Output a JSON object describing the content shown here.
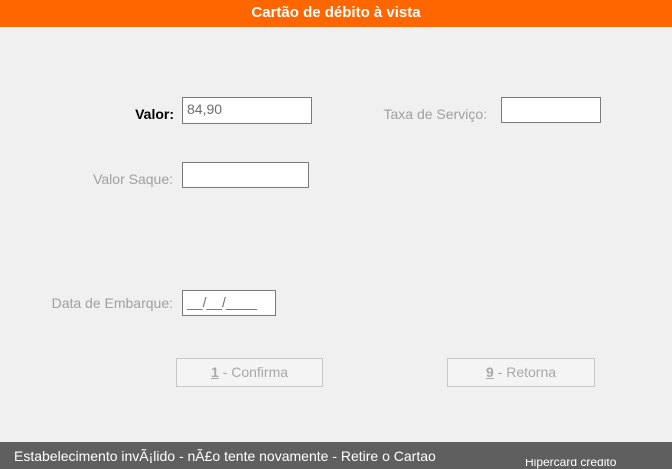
{
  "window": {
    "title": "Cartão de débito à vista"
  },
  "form": {
    "valor_label": "Valor:",
    "valor_value": "84,90",
    "taxa_label": "Taxa de Serviço:",
    "taxa_value": "",
    "saque_label": "Valor Saque:",
    "saque_value": "",
    "embarque_label": "Data de Embarque:",
    "embarque_value": "__/__/____"
  },
  "buttons": {
    "confirma_key": "1",
    "confirma_text": " - Confirma",
    "retorna_key": "9",
    "retorna_text": " - Retorna"
  },
  "status": {
    "message": "Estabelecimento invÃ¡lido - nÃ£o tente novamente - Retire o Cartao",
    "tail_text": "Hipercard crédito"
  }
}
